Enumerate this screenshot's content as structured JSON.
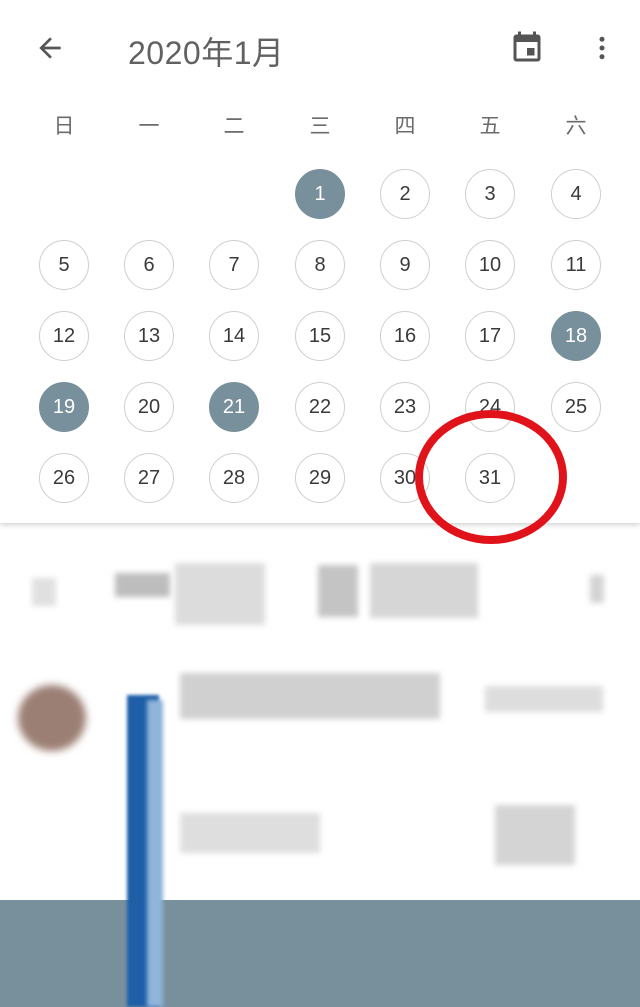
{
  "header": {
    "title": "2020年1月",
    "back_icon": "arrow-back-icon",
    "calendar_icon": "calendar-icon",
    "more_icon": "more-vert-icon"
  },
  "weekdays": [
    "日",
    "一",
    "二",
    "三",
    "四",
    "五",
    "六"
  ],
  "days": [
    "1",
    "2",
    "3",
    "4",
    "5",
    "6",
    "7",
    "8",
    "9",
    "10",
    "11",
    "12",
    "13",
    "14",
    "15",
    "16",
    "17",
    "18",
    "19",
    "20",
    "21",
    "22",
    "23",
    "24",
    "25",
    "26",
    "27",
    "28",
    "29",
    "30",
    "31"
  ],
  "event_days": [
    "1",
    "18",
    "19",
    "21"
  ],
  "colors": {
    "event_fill": "#78909c",
    "annotation": "#e0131b",
    "bottom_bar": "#78909c"
  },
  "annotation": {
    "shape": "red circle",
    "target_day": "31"
  }
}
